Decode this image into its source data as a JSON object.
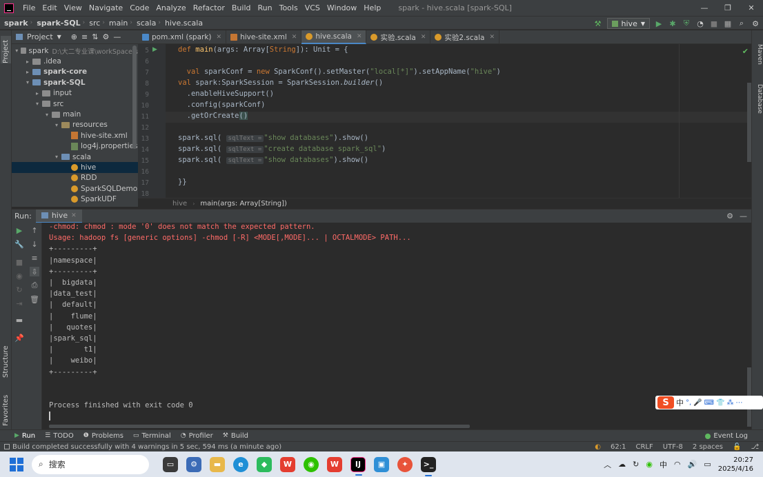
{
  "window": {
    "title": "spark - hive.scala [spark-SQL]",
    "menu": [
      "File",
      "Edit",
      "View",
      "Navigate",
      "Code",
      "Analyze",
      "Refactor",
      "Build",
      "Run",
      "Tools",
      "VCS",
      "Window",
      "Help"
    ]
  },
  "breadcrumb": [
    "spark",
    "spark-SQL",
    "src",
    "main",
    "scala",
    "hive.scala"
  ],
  "run_config": "hive",
  "project_panel": {
    "title": "Project",
    "tree": [
      {
        "label": "spark",
        "extra": "D:\\大二专业课\\workSpace\\s",
        "indent": 0,
        "arrow": "▾",
        "icon": "folder"
      },
      {
        "label": ".idea",
        "indent": 1,
        "arrow": "▸",
        "icon": "folder"
      },
      {
        "label": "spark-core",
        "indent": 1,
        "arrow": "▸",
        "icon": "folder-blue",
        "bold": true
      },
      {
        "label": "spark-SQL",
        "indent": 1,
        "arrow": "▾",
        "icon": "folder-blue",
        "bold": true
      },
      {
        "label": "input",
        "indent": 2,
        "arrow": "▸",
        "icon": "folder"
      },
      {
        "label": "src",
        "indent": 2,
        "arrow": "▾",
        "icon": "folder"
      },
      {
        "label": "main",
        "indent": 3,
        "arrow": "▾",
        "icon": "folder"
      },
      {
        "label": "resources",
        "indent": 4,
        "arrow": "▾",
        "icon": "folder-res"
      },
      {
        "label": "hive-site.xml",
        "indent": 5,
        "arrow": "",
        "icon": "xml"
      },
      {
        "label": "log4j.properties",
        "indent": 5,
        "arrow": "",
        "icon": "props"
      },
      {
        "label": "scala",
        "indent": 4,
        "arrow": "▾",
        "icon": "folder-blue"
      },
      {
        "label": "hive",
        "indent": 5,
        "arrow": "",
        "icon": "scala",
        "selected": true
      },
      {
        "label": "RDD",
        "indent": 5,
        "arrow": "",
        "icon": "scala"
      },
      {
        "label": "SparkSQLDemo",
        "indent": 5,
        "arrow": "",
        "icon": "scala"
      },
      {
        "label": "SparkUDF",
        "indent": 5,
        "arrow": "",
        "icon": "scala"
      }
    ]
  },
  "tabs": [
    {
      "label": "pom.xml (spark)",
      "icon_color": "#4a88c7",
      "active": false
    },
    {
      "label": "hive-site.xml",
      "icon_color": "#c57633",
      "active": false
    },
    {
      "label": "hive.scala",
      "icon_color": "#d99a2b",
      "active": true
    },
    {
      "label": "实验.scala",
      "icon_color": "#d99a2b",
      "active": false
    },
    {
      "label": "实验2.scala",
      "icon_color": "#d99a2b",
      "active": false
    }
  ],
  "editor": {
    "line_numbers": [
      "5",
      "6",
      "7",
      "8",
      "9",
      "10",
      "11",
      "12",
      "13",
      "14",
      "15",
      "16",
      "17",
      "18"
    ],
    "hint_label": "sqlText =",
    "breadcrumbs": [
      "hive",
      "main(args: Array[String])"
    ]
  },
  "run_panel": {
    "label": "Run:",
    "tab": "hive",
    "output": [
      {
        "text": "-chmod: chmod : mode '0' does not match the expected pattern.",
        "err": true
      },
      {
        "text": "Usage: hadoop fs [generic options] -chmod [-R] <MODE[,MODE]... | OCTALMODE> PATH...",
        "err": true
      },
      {
        "text": "+---------+",
        "err": false
      },
      {
        "text": "|namespace|",
        "err": false
      },
      {
        "text": "+---------+",
        "err": false
      },
      {
        "text": "|  bigdata|",
        "err": false
      },
      {
        "text": "|data_test|",
        "err": false
      },
      {
        "text": "|  default|",
        "err": false
      },
      {
        "text": "|    flume|",
        "err": false
      },
      {
        "text": "|   quotes|",
        "err": false
      },
      {
        "text": "|spark_sql|",
        "err": false
      },
      {
        "text": "|       t1|",
        "err": false
      },
      {
        "text": "|    weibo|",
        "err": false
      },
      {
        "text": "+---------+",
        "err": false
      },
      {
        "text": "",
        "err": false
      },
      {
        "text": "",
        "err": false
      },
      {
        "text": "Process finished with exit code 0",
        "err": false
      }
    ]
  },
  "tool_tabs": [
    "Run",
    "TODO",
    "Problems",
    "Terminal",
    "Profiler",
    "Build"
  ],
  "event_log": "Event Log",
  "status": {
    "message": "Build completed successfully with 4 warnings in 5 sec, 594 ms (a minute ago)",
    "position": "62:1",
    "line_sep": "CRLF",
    "encoding": "UTF-8",
    "indent": "2 spaces"
  },
  "side_labels": {
    "project": "Project",
    "structure": "Structure",
    "favorites": "Favorites",
    "maven": "Maven",
    "database": "Database"
  },
  "ime": {
    "lang": "中"
  },
  "taskbar": {
    "search_placeholder": "搜索",
    "time": "20:27",
    "date": "2025/4/16"
  }
}
